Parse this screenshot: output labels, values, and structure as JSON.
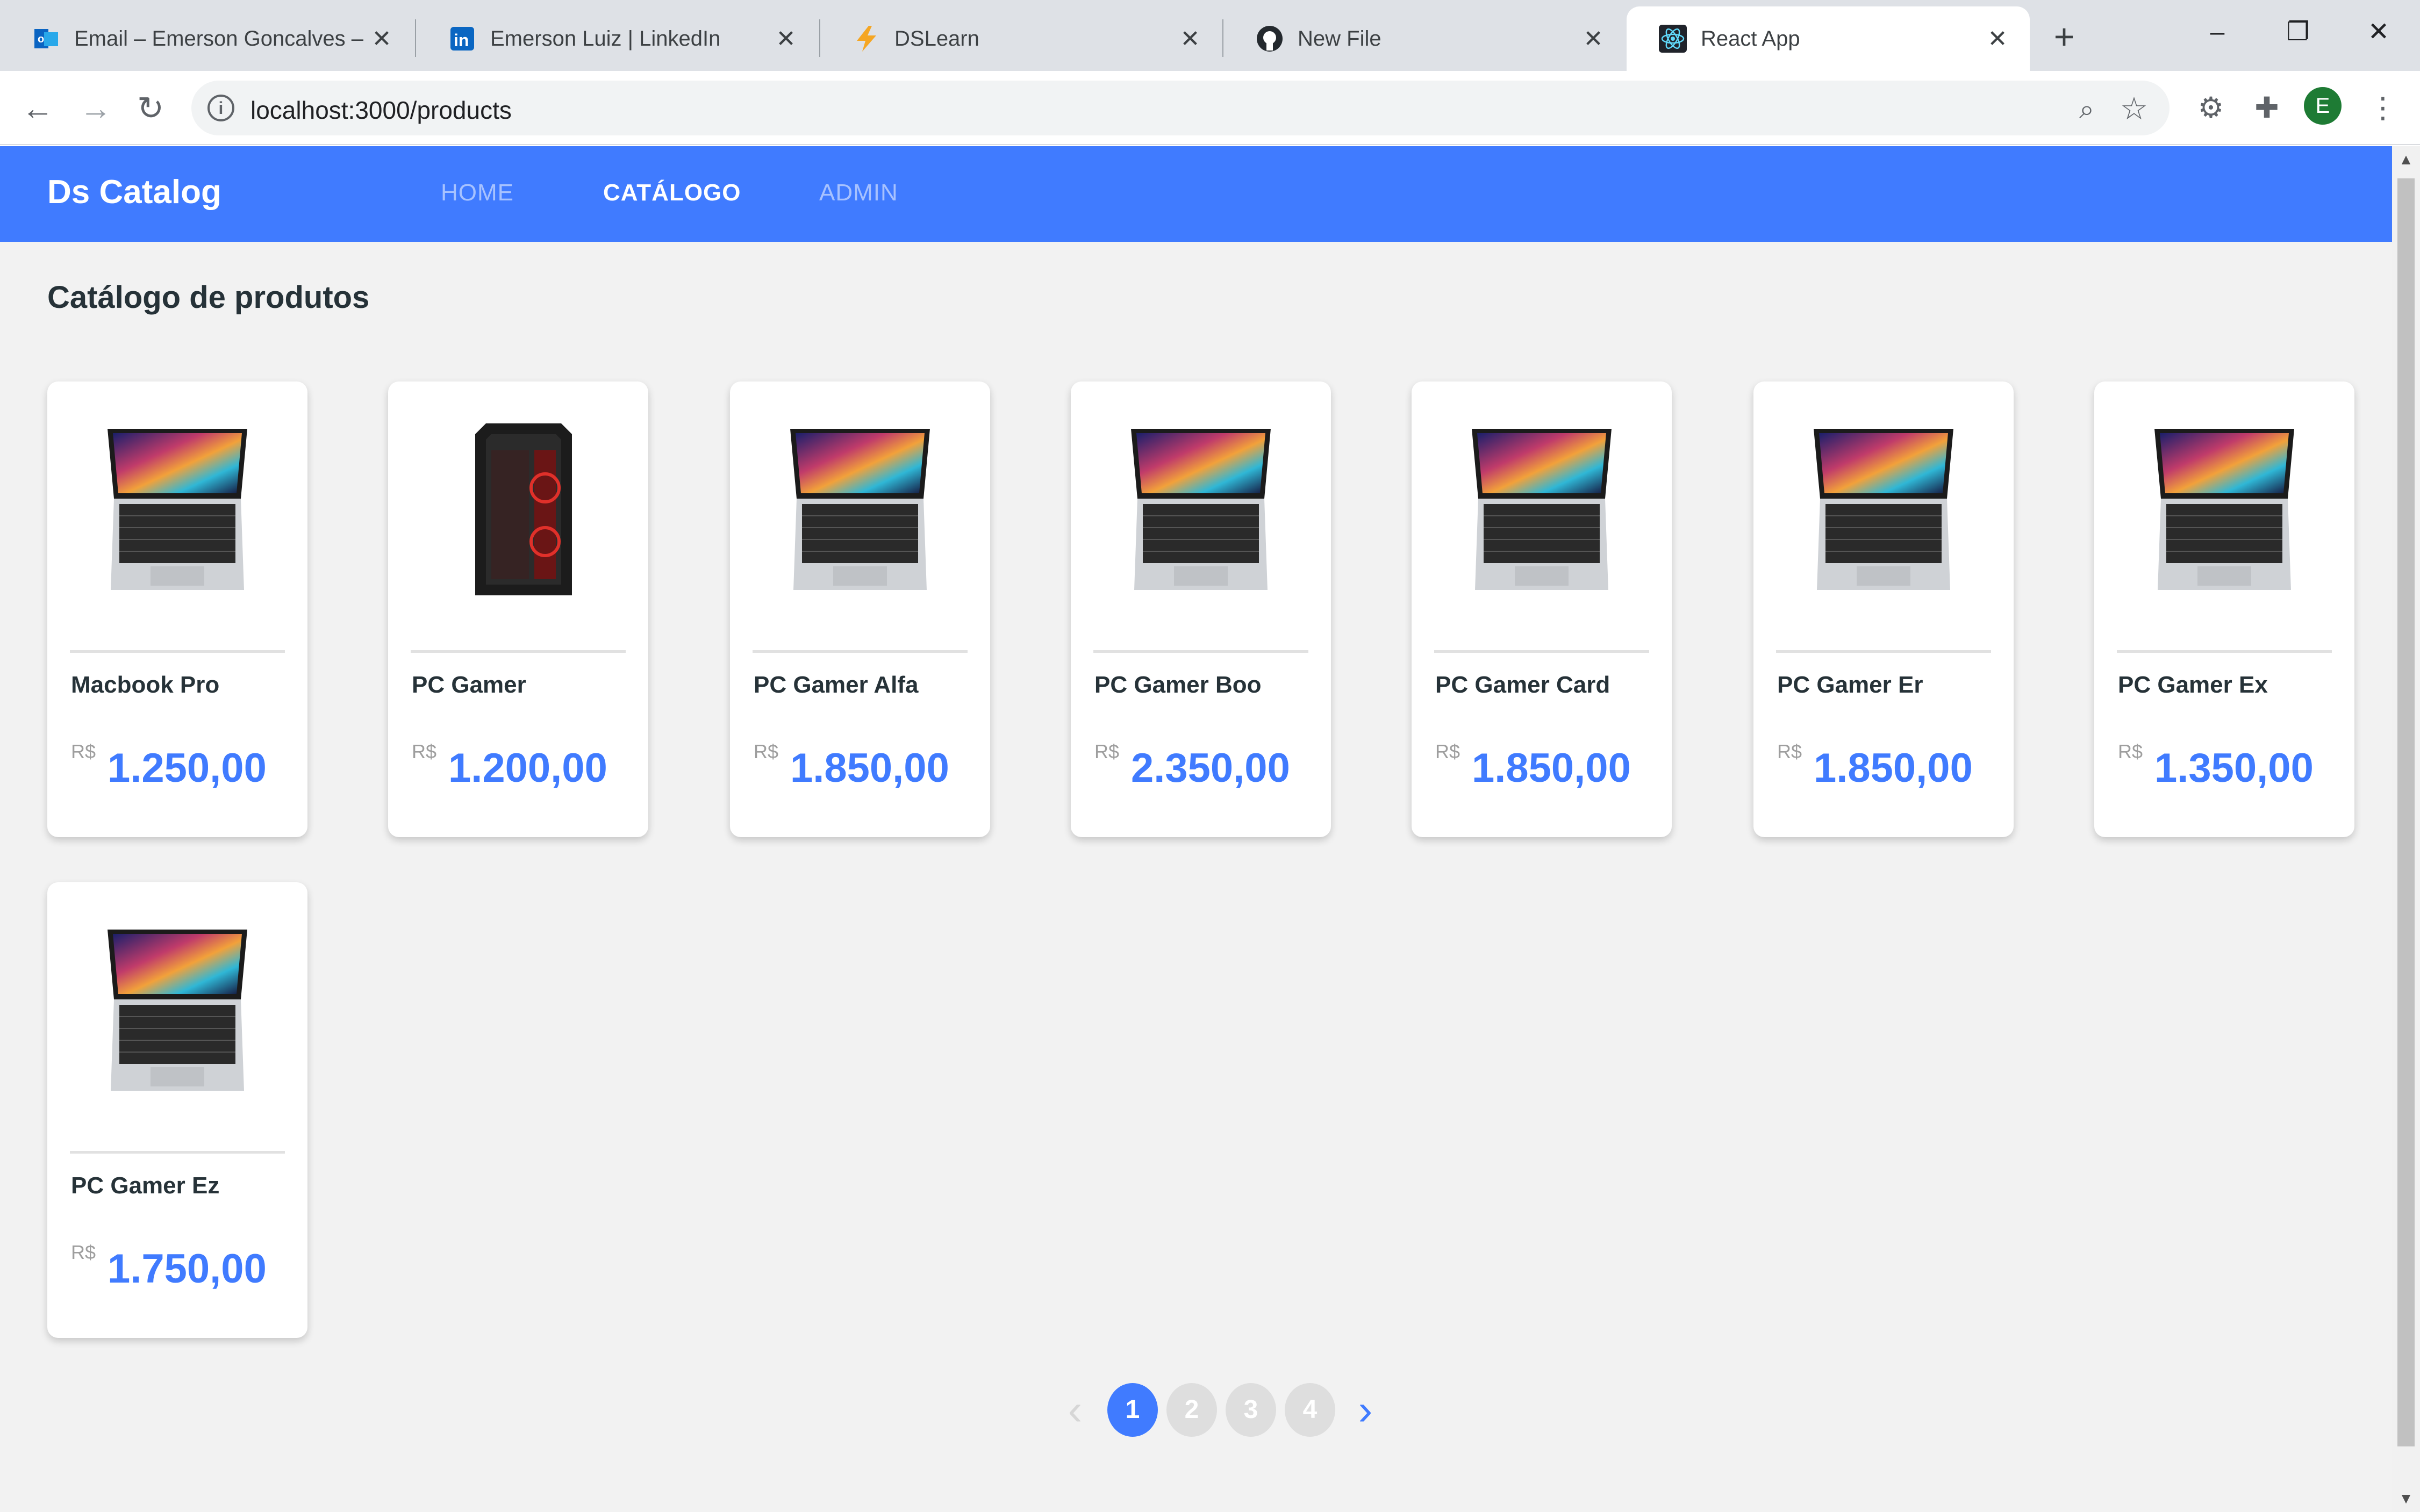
{
  "browser": {
    "tabs": [
      {
        "title": "Email – Emerson Goncalves – Outlook",
        "icon": "outlook-icon",
        "active": false
      },
      {
        "title": "Emerson Luiz | LinkedIn",
        "icon": "linkedin-icon",
        "active": false
      },
      {
        "title": "DSLearn",
        "icon": "lightning-icon",
        "active": false
      },
      {
        "title": "New File",
        "icon": "github-icon",
        "active": false
      },
      {
        "title": "React App",
        "icon": "react-icon",
        "active": true
      }
    ],
    "url": "localhost:3000/products",
    "avatar_letter": "E"
  },
  "navbar": {
    "brand": "Ds Catalog",
    "links": [
      {
        "label": "HOME",
        "active": false
      },
      {
        "label": "CATÁLOGO",
        "active": true
      },
      {
        "label": "ADMIN",
        "active": false
      }
    ]
  },
  "page": {
    "title": "Catálogo de produtos"
  },
  "products": [
    {
      "name": "Macbook Pro",
      "currency": "R$",
      "price": "1.250,00",
      "image": "laptop"
    },
    {
      "name": "PC Gamer",
      "currency": "R$",
      "price": "1.200,00",
      "image": "pc-tower"
    },
    {
      "name": "PC Gamer Alfa",
      "currency": "R$",
      "price": "1.850,00",
      "image": "laptop"
    },
    {
      "name": "PC Gamer Boo",
      "currency": "R$",
      "price": "2.350,00",
      "image": "laptop"
    },
    {
      "name": "PC Gamer Card",
      "currency": "R$",
      "price": "1.850,00",
      "image": "laptop"
    },
    {
      "name": "PC Gamer Er",
      "currency": "R$",
      "price": "1.850,00",
      "image": "laptop"
    },
    {
      "name": "PC Gamer Ex",
      "currency": "R$",
      "price": "1.350,00",
      "image": "laptop"
    },
    {
      "name": "PC Gamer Ez",
      "currency": "R$",
      "price": "1.750,00",
      "image": "laptop"
    }
  ],
  "pagination": {
    "pages": [
      "1",
      "2",
      "3",
      "4"
    ],
    "current": "1",
    "prev_icon": "chevron-left-icon",
    "next_icon": "chevron-right-icon"
  },
  "colors": {
    "primary": "#407bff",
    "background": "#f2f2f2",
    "text_dark": "#263238"
  }
}
